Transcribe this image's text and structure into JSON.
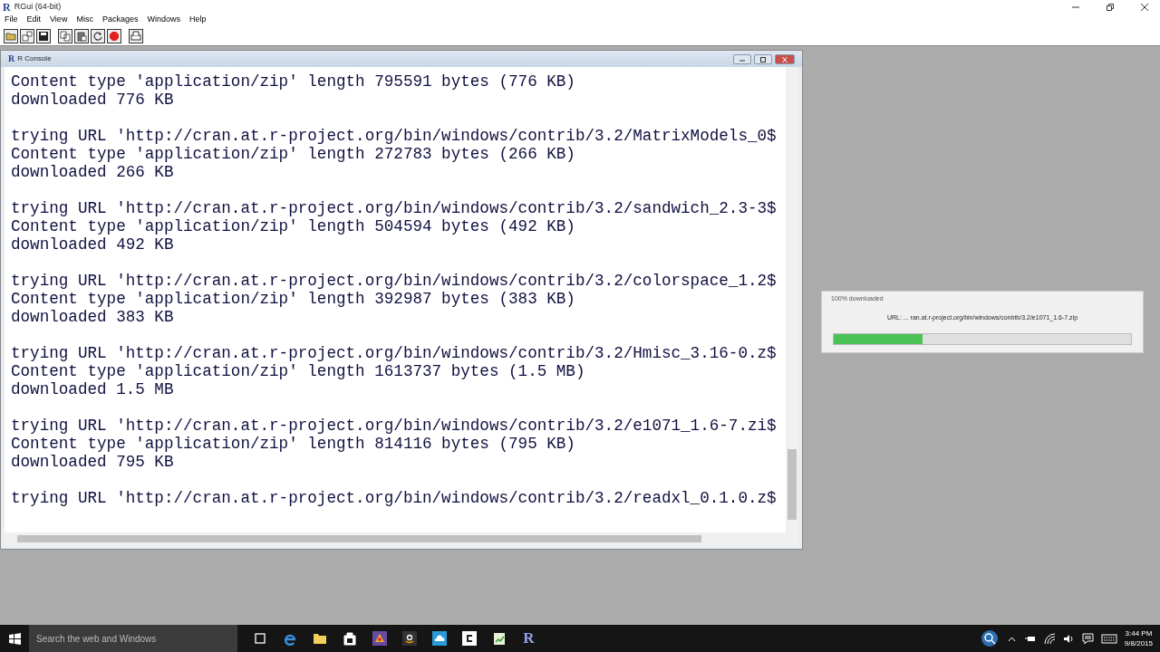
{
  "app_window": {
    "logo": "R",
    "title": "RGui (64-bit)",
    "menu": [
      "File",
      "Edit",
      "View",
      "Misc",
      "Packages",
      "Windows",
      "Help"
    ]
  },
  "console": {
    "logo": "R",
    "title": "R Console",
    "blocks": [
      {
        "lines": [
          "Content type 'application/zip' length 795591 bytes (776 KB)",
          "downloaded 776 KB"
        ]
      },
      {
        "lines": [
          "trying URL 'http://cran.at.r-project.org/bin/windows/contrib/3.2/MatrixModels_0$",
          "Content type 'application/zip' length 272783 bytes (266 KB)",
          "downloaded 266 KB"
        ]
      },
      {
        "lines": [
          "trying URL 'http://cran.at.r-project.org/bin/windows/contrib/3.2/sandwich_2.3-3$",
          "Content type 'application/zip' length 504594 bytes (492 KB)",
          "downloaded 492 KB"
        ]
      },
      {
        "lines": [
          "trying URL 'http://cran.at.r-project.org/bin/windows/contrib/3.2/colorspace_1.2$",
          "Content type 'application/zip' length 392987 bytes (383 KB)",
          "downloaded 383 KB"
        ]
      },
      {
        "lines": [
          "trying URL 'http://cran.at.r-project.org/bin/windows/contrib/3.2/Hmisc_3.16-0.z$",
          "Content type 'application/zip' length 1613737 bytes (1.5 MB)",
          "downloaded 1.5 MB"
        ]
      },
      {
        "lines": [
          "trying URL 'http://cran.at.r-project.org/bin/windows/contrib/3.2/e1071_1.6-7.zi$",
          "Content type 'application/zip' length 814116 bytes (795 KB)",
          "downloaded 795 KB"
        ]
      },
      {
        "lines": [
          "trying URL 'http://cran.at.r-project.org/bin/windows/contrib/3.2/readxl_0.1.0.z$"
        ]
      }
    ]
  },
  "download_dialog": {
    "title": "100% downloaded",
    "url": "URL: ... ran.at.r-project.org/bin/windows/contrib/3.2/e1071_1.6-7.zip",
    "level": 0.3
  },
  "taskbar": {
    "r_app_logo": "R",
    "search": {
      "placeholder": "Search the web and Windows"
    },
    "clock": {
      "time": "3:44 PM",
      "date": "9/8/2015"
    }
  }
}
